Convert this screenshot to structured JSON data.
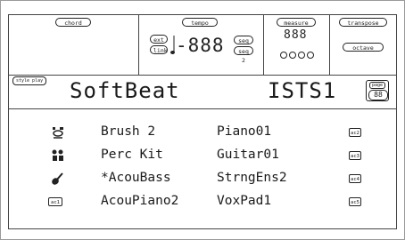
{
  "header": {
    "chord_label": "chord",
    "tempo_label": "tempo",
    "tempo_ext": "ext",
    "tempo_link": "link",
    "tempo_value": "-888",
    "seq1": "seq 1",
    "seq2": "seq 2",
    "measure_label": "measure",
    "measure_value": "888",
    "transpose_label": "transpose",
    "octave_label": "octave"
  },
  "style": {
    "mode_label": "style play",
    "name": "SoftBeat",
    "code": "ISTS1",
    "page_label": "page",
    "page_value": "88"
  },
  "tracks": [
    {
      "icon": "drum-kit-icon",
      "name": "Brush 2",
      "name2": "Piano01",
      "badge": "ac2"
    },
    {
      "icon": "percussion-icon",
      "name": "Perc Kit",
      "name2": "Guitar01",
      "badge": "ac3"
    },
    {
      "icon": "bass-icon",
      "name": "*AcouBass",
      "name2": "StrngEns2",
      "badge": "ac4"
    },
    {
      "icon": "accompaniment-badge",
      "badge_left": "ac1",
      "name": "AcouPiano2",
      "name2": "VoxPad1",
      "badge": "ac5"
    }
  ]
}
